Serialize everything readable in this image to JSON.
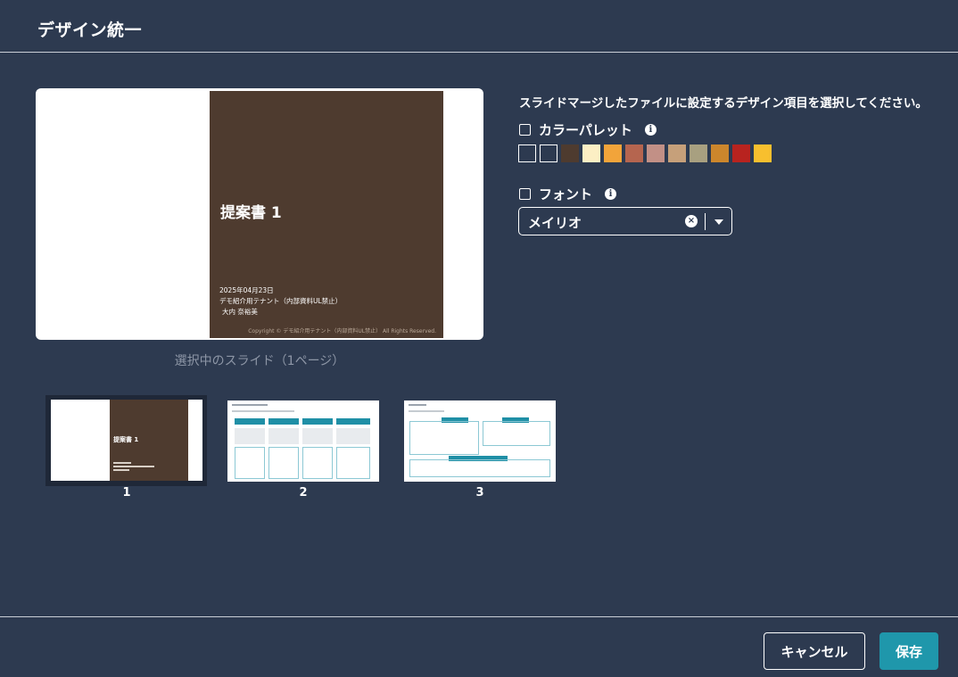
{
  "dialog": {
    "title": "デザイン統一"
  },
  "preview": {
    "slide_title": "提案書 1",
    "date": "2025年04月23日",
    "company": "デモ紹介用テナント（内部資料UL禁止）",
    "person": "大内 奈裕美",
    "copyright": "Copyright © デモ紹介用テナント（内部資料UL禁止） All Rights Reserved.",
    "caption": "選択中のスライド（1ページ）"
  },
  "settings": {
    "instruction": "スライドマージしたファイルに設定するデザイン項目を選択してください。",
    "color_palette": {
      "label": "カラーパレット",
      "checked": false,
      "icon": "info-icon",
      "swatches": [
        "#2d3a50",
        "#2d3a50",
        "#4e3b2f",
        "#fcefc4",
        "#f2a43a",
        "#b5654f",
        "#c29086",
        "#c6a07a",
        "#a8a080",
        "#cc862c",
        "#b8231f",
        "#f8bf2e"
      ]
    },
    "font": {
      "label": "フォント",
      "checked": false,
      "icon": "info-icon",
      "selected": "メイリオ",
      "clear_icon": "clear-icon",
      "dropdown_icon": "chevron-down-icon"
    }
  },
  "thumbnails": [
    {
      "number": "1",
      "selected": true,
      "title": "提案書 1"
    },
    {
      "number": "2",
      "selected": false
    },
    {
      "number": "3",
      "selected": false
    }
  ],
  "footer": {
    "cancel_label": "キャンセル",
    "save_label": "保存"
  }
}
